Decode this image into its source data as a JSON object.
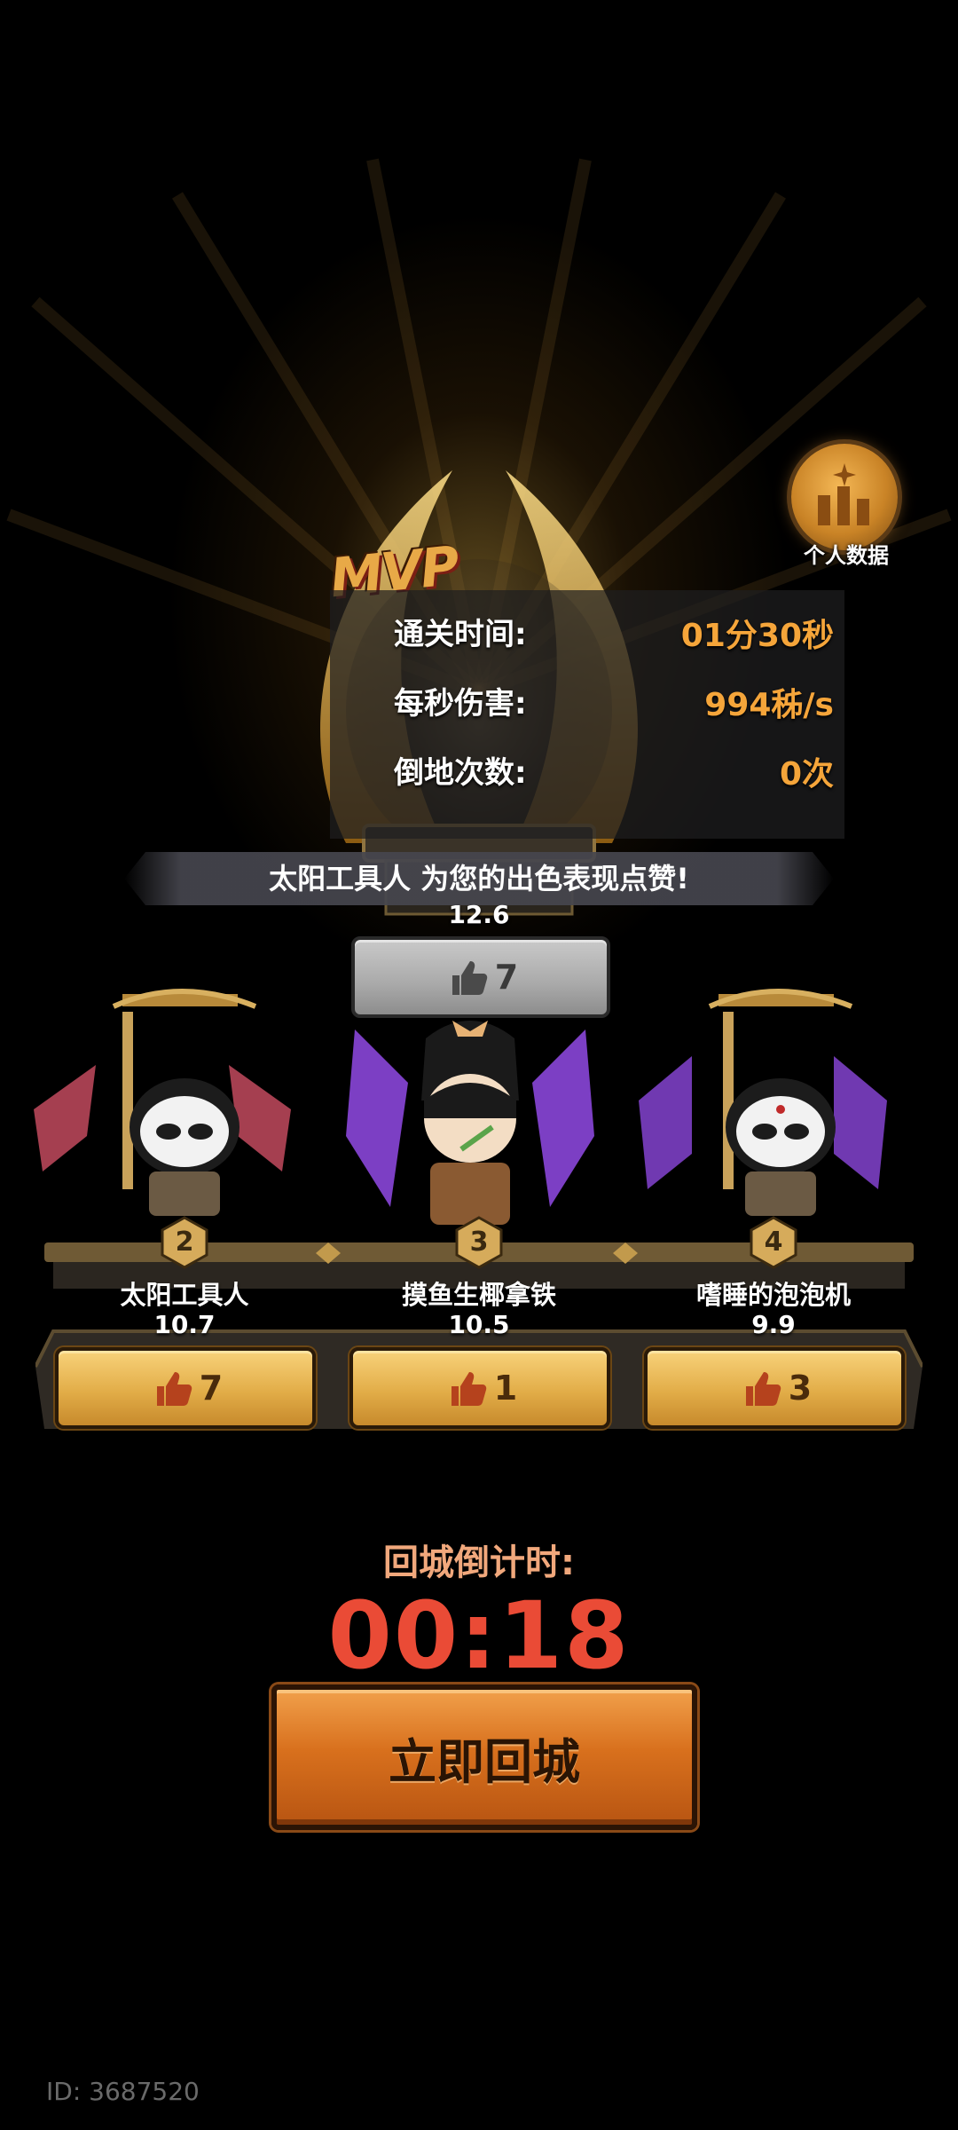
{
  "personal_data": {
    "label": "个人数据",
    "icon": "bar-chart-icon"
  },
  "mvp": {
    "logo": "MVP",
    "stats": [
      {
        "label": "通关时间:",
        "value": "01分30秒"
      },
      {
        "label": "每秒伤害:",
        "value": "994秭/s"
      },
      {
        "label": "倒地次数:",
        "value": "0次"
      }
    ],
    "praise_message": "太阳工具人 为您的出色表现点赞!",
    "score": "12.6",
    "likes": "7"
  },
  "players": [
    {
      "rank": "2",
      "name": "太阳工具人",
      "score": "10.7",
      "likes": "7"
    },
    {
      "rank": "3",
      "name": "摸鱼生椰拿铁",
      "score": "10.5",
      "likes": "1"
    },
    {
      "rank": "4",
      "name": "嗜睡的泡泡机",
      "score": "9.9",
      "likes": "3"
    }
  ],
  "countdown": {
    "label": "回城倒计时:",
    "time": "00:18"
  },
  "return_button": {
    "label": "立即回城"
  },
  "footer": {
    "id_text": "ID: 3687520"
  },
  "colors": {
    "gold_text": "#f5a53a",
    "timer_red": "#ea4b36",
    "button_orange": "#d8701d"
  }
}
